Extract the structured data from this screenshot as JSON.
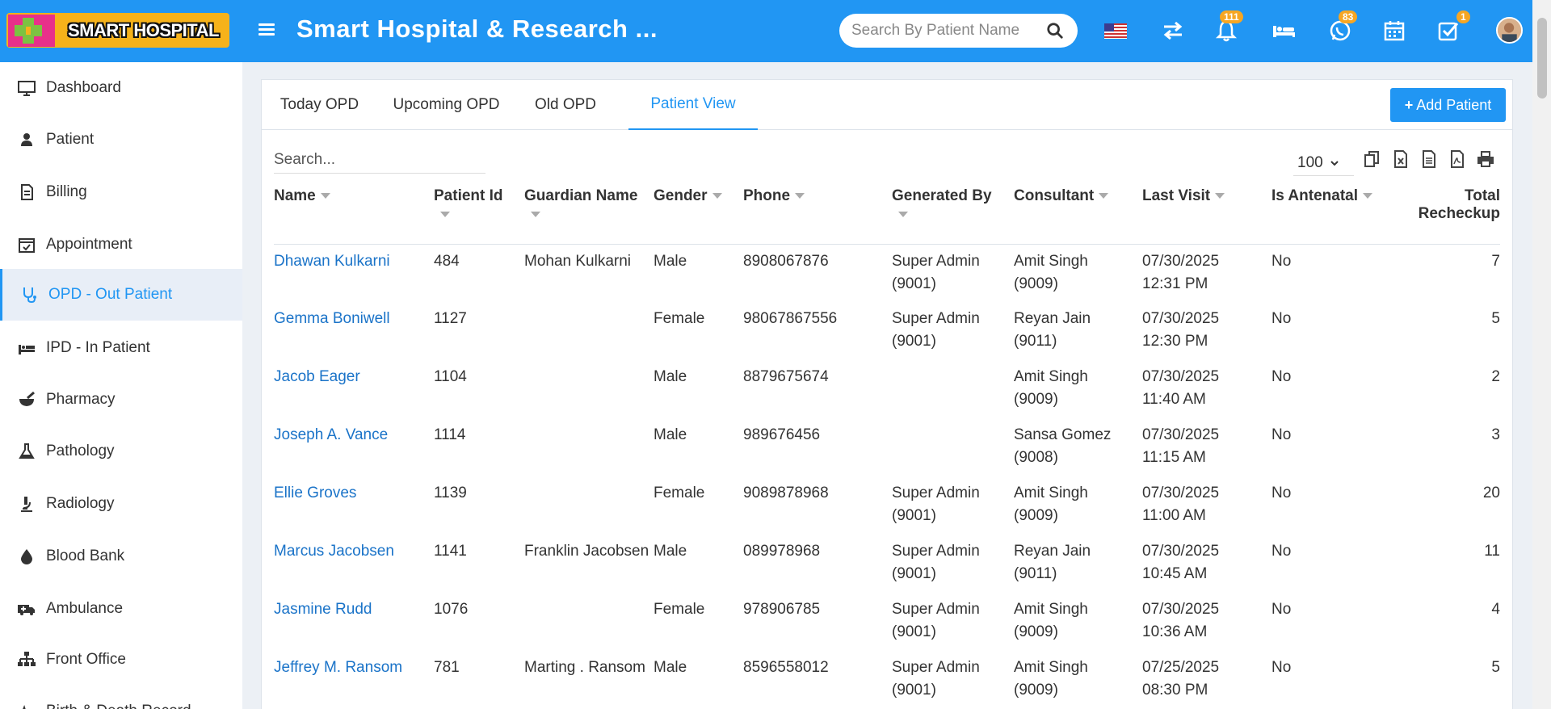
{
  "header": {
    "logo_text": "SMART HOSPITAL",
    "app_title": "Smart Hospital & Research ...",
    "search_placeholder": "Search By Patient Name",
    "notifications_count": "111",
    "whatsapp_count": "83",
    "tasks_count": "1"
  },
  "sidebar": {
    "items": [
      {
        "label": "Dashboard",
        "icon": "monitor-icon"
      },
      {
        "label": "Patient",
        "icon": "user-icon"
      },
      {
        "label": "Billing",
        "icon": "invoice-icon"
      },
      {
        "label": "Appointment",
        "icon": "calendar-check-icon"
      },
      {
        "label": "OPD - Out Patient",
        "icon": "stethoscope-icon"
      },
      {
        "label": "IPD - In Patient",
        "icon": "bed-icon"
      },
      {
        "label": "Pharmacy",
        "icon": "mortar-pestle-icon"
      },
      {
        "label": "Pathology",
        "icon": "flask-icon"
      },
      {
        "label": "Radiology",
        "icon": "microscope-icon"
      },
      {
        "label": "Blood Bank",
        "icon": "blood-drop-icon"
      },
      {
        "label": "Ambulance",
        "icon": "ambulance-icon"
      },
      {
        "label": "Front Office",
        "icon": "sitemap-icon"
      },
      {
        "label": "Birth & Death Record",
        "icon": "heartbeat-icon"
      }
    ],
    "active": "OPD - Out Patient"
  },
  "tabs": [
    "Today OPD",
    "Upcoming OPD",
    "Old OPD",
    "Patient View"
  ],
  "active_tab": "Patient View",
  "add_button": "Add Patient",
  "table_search_placeholder": "Search...",
  "page_size": "100",
  "columns": [
    "Name",
    "Patient Id",
    "Guardian Name",
    "Gender",
    "Phone",
    "Generated By",
    "Consultant",
    "Last Visit",
    "Is Antenatal",
    "Total",
    "Recheckup"
  ],
  "rows": [
    {
      "name": "Dhawan Kulkarni",
      "id": "484",
      "guardian": "Mohan Kulkarni",
      "gender": "Male",
      "phone": "8908067876",
      "gen1": "Super Admin",
      "gen2": "(9001)",
      "con1": "Amit Singh",
      "con2": "(9009)",
      "date": "07/30/2025",
      "time": "12:31 PM",
      "antenatal": "No",
      "total": "7"
    },
    {
      "name": "Gemma Boniwell",
      "id": "1127",
      "guardian": "",
      "gender": "Female",
      "phone": "98067867556",
      "gen1": "Super Admin",
      "gen2": "(9001)",
      "con1": "Reyan Jain",
      "con2": "(9011)",
      "date": "07/30/2025",
      "time": "12:30 PM",
      "antenatal": "No",
      "total": "5"
    },
    {
      "name": "Jacob Eager",
      "id": "1104",
      "guardian": "",
      "gender": "Male",
      "phone": "8879675674",
      "gen1": "",
      "gen2": "",
      "con1": "Amit Singh",
      "con2": "(9009)",
      "date": "07/30/2025",
      "time": "11:40 AM",
      "antenatal": "No",
      "total": "2"
    },
    {
      "name": "Joseph A. Vance",
      "id": "1114",
      "guardian": "",
      "gender": "Male",
      "phone": "989676456",
      "gen1": "",
      "gen2": "",
      "con1": "Sansa Gomez",
      "con2": "(9008)",
      "date": "07/30/2025",
      "time": "11:15 AM",
      "antenatal": "No",
      "total": "3"
    },
    {
      "name": "Ellie Groves",
      "id": "1139",
      "guardian": "",
      "gender": "Female",
      "phone": "9089878968",
      "gen1": "Super Admin",
      "gen2": "(9001)",
      "con1": "Amit Singh",
      "con2": "(9009)",
      "date": "07/30/2025",
      "time": "11:00 AM",
      "antenatal": "No",
      "total": "20"
    },
    {
      "name": "Marcus Jacobsen",
      "id": "1141",
      "guardian": "Franklin Jacobsen",
      "gender": "Male",
      "phone": "089978968",
      "gen1": "Super Admin",
      "gen2": "(9001)",
      "con1": "Reyan Jain",
      "con2": "(9011)",
      "date": "07/30/2025",
      "time": "10:45 AM",
      "antenatal": "No",
      "total": "11"
    },
    {
      "name": "Jasmine Rudd",
      "id": "1076",
      "guardian": "",
      "gender": "Female",
      "phone": "978906785",
      "gen1": "Super Admin",
      "gen2": "(9001)",
      "con1": "Amit Singh",
      "con2": "(9009)",
      "date": "07/30/2025",
      "time": "10:36 AM",
      "antenatal": "No",
      "total": "4"
    },
    {
      "name": "Jeffrey M. Ransom",
      "id": "781",
      "guardian": "Marting . Ransom",
      "gender": "Male",
      "phone": "8596558012",
      "gen1": "Super Admin",
      "gen2": "(9001)",
      "con1": "Amit Singh",
      "con2": "(9009)",
      "date": "07/25/2025",
      "time": "08:30 PM",
      "antenatal": "No",
      "total": "5"
    }
  ],
  "colors": {
    "primary": "#2196f3",
    "logo": "#f6b21a",
    "link": "#1a73c8",
    "badge": "#f6a623"
  }
}
